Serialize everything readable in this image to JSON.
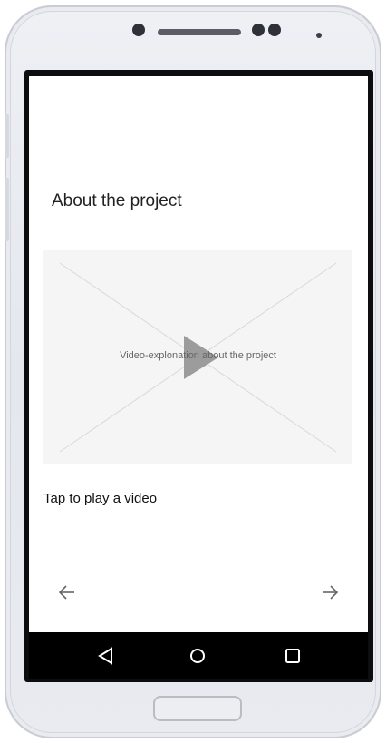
{
  "screen": {
    "title": "About the project",
    "video": {
      "caption": "Video-explonation about the project",
      "play_icon": "play-icon"
    },
    "hint": "Tap to play a video",
    "navigation": {
      "back_icon": "arrow-left-icon",
      "forward_icon": "arrow-right-icon"
    }
  },
  "system_nav": {
    "back_icon": "triangle-back-icon",
    "home_icon": "circle-home-icon",
    "recents_icon": "square-recents-icon"
  },
  "colors": {
    "video_background": "#f5f5f5",
    "play_icon": "#9c9c9c",
    "nav_bar": "#000000",
    "device_frame": "#e9ebf0"
  }
}
